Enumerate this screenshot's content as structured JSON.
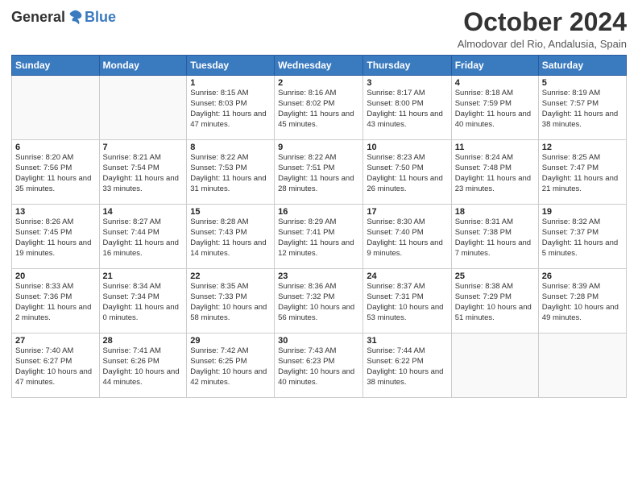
{
  "logo": {
    "general": "General",
    "blue": "Blue"
  },
  "title": "October 2024",
  "subtitle": "Almodovar del Rio, Andalusia, Spain",
  "days_header": [
    "Sunday",
    "Monday",
    "Tuesday",
    "Wednesday",
    "Thursday",
    "Friday",
    "Saturday"
  ],
  "weeks": [
    [
      {
        "day": "",
        "info": ""
      },
      {
        "day": "",
        "info": ""
      },
      {
        "day": "1",
        "info": "Sunrise: 8:15 AM\nSunset: 8:03 PM\nDaylight: 11 hours and 47 minutes."
      },
      {
        "day": "2",
        "info": "Sunrise: 8:16 AM\nSunset: 8:02 PM\nDaylight: 11 hours and 45 minutes."
      },
      {
        "day": "3",
        "info": "Sunrise: 8:17 AM\nSunset: 8:00 PM\nDaylight: 11 hours and 43 minutes."
      },
      {
        "day": "4",
        "info": "Sunrise: 8:18 AM\nSunset: 7:59 PM\nDaylight: 11 hours and 40 minutes."
      },
      {
        "day": "5",
        "info": "Sunrise: 8:19 AM\nSunset: 7:57 PM\nDaylight: 11 hours and 38 minutes."
      }
    ],
    [
      {
        "day": "6",
        "info": "Sunrise: 8:20 AM\nSunset: 7:56 PM\nDaylight: 11 hours and 35 minutes."
      },
      {
        "day": "7",
        "info": "Sunrise: 8:21 AM\nSunset: 7:54 PM\nDaylight: 11 hours and 33 minutes."
      },
      {
        "day": "8",
        "info": "Sunrise: 8:22 AM\nSunset: 7:53 PM\nDaylight: 11 hours and 31 minutes."
      },
      {
        "day": "9",
        "info": "Sunrise: 8:22 AM\nSunset: 7:51 PM\nDaylight: 11 hours and 28 minutes."
      },
      {
        "day": "10",
        "info": "Sunrise: 8:23 AM\nSunset: 7:50 PM\nDaylight: 11 hours and 26 minutes."
      },
      {
        "day": "11",
        "info": "Sunrise: 8:24 AM\nSunset: 7:48 PM\nDaylight: 11 hours and 23 minutes."
      },
      {
        "day": "12",
        "info": "Sunrise: 8:25 AM\nSunset: 7:47 PM\nDaylight: 11 hours and 21 minutes."
      }
    ],
    [
      {
        "day": "13",
        "info": "Sunrise: 8:26 AM\nSunset: 7:45 PM\nDaylight: 11 hours and 19 minutes."
      },
      {
        "day": "14",
        "info": "Sunrise: 8:27 AM\nSunset: 7:44 PM\nDaylight: 11 hours and 16 minutes."
      },
      {
        "day": "15",
        "info": "Sunrise: 8:28 AM\nSunset: 7:43 PM\nDaylight: 11 hours and 14 minutes."
      },
      {
        "day": "16",
        "info": "Sunrise: 8:29 AM\nSunset: 7:41 PM\nDaylight: 11 hours and 12 minutes."
      },
      {
        "day": "17",
        "info": "Sunrise: 8:30 AM\nSunset: 7:40 PM\nDaylight: 11 hours and 9 minutes."
      },
      {
        "day": "18",
        "info": "Sunrise: 8:31 AM\nSunset: 7:38 PM\nDaylight: 11 hours and 7 minutes."
      },
      {
        "day": "19",
        "info": "Sunrise: 8:32 AM\nSunset: 7:37 PM\nDaylight: 11 hours and 5 minutes."
      }
    ],
    [
      {
        "day": "20",
        "info": "Sunrise: 8:33 AM\nSunset: 7:36 PM\nDaylight: 11 hours and 2 minutes."
      },
      {
        "day": "21",
        "info": "Sunrise: 8:34 AM\nSunset: 7:34 PM\nDaylight: 11 hours and 0 minutes."
      },
      {
        "day": "22",
        "info": "Sunrise: 8:35 AM\nSunset: 7:33 PM\nDaylight: 10 hours and 58 minutes."
      },
      {
        "day": "23",
        "info": "Sunrise: 8:36 AM\nSunset: 7:32 PM\nDaylight: 10 hours and 56 minutes."
      },
      {
        "day": "24",
        "info": "Sunrise: 8:37 AM\nSunset: 7:31 PM\nDaylight: 10 hours and 53 minutes."
      },
      {
        "day": "25",
        "info": "Sunrise: 8:38 AM\nSunset: 7:29 PM\nDaylight: 10 hours and 51 minutes."
      },
      {
        "day": "26",
        "info": "Sunrise: 8:39 AM\nSunset: 7:28 PM\nDaylight: 10 hours and 49 minutes."
      }
    ],
    [
      {
        "day": "27",
        "info": "Sunrise: 7:40 AM\nSunset: 6:27 PM\nDaylight: 10 hours and 47 minutes."
      },
      {
        "day": "28",
        "info": "Sunrise: 7:41 AM\nSunset: 6:26 PM\nDaylight: 10 hours and 44 minutes."
      },
      {
        "day": "29",
        "info": "Sunrise: 7:42 AM\nSunset: 6:25 PM\nDaylight: 10 hours and 42 minutes."
      },
      {
        "day": "30",
        "info": "Sunrise: 7:43 AM\nSunset: 6:23 PM\nDaylight: 10 hours and 40 minutes."
      },
      {
        "day": "31",
        "info": "Sunrise: 7:44 AM\nSunset: 6:22 PM\nDaylight: 10 hours and 38 minutes."
      },
      {
        "day": "",
        "info": ""
      },
      {
        "day": "",
        "info": ""
      }
    ]
  ]
}
